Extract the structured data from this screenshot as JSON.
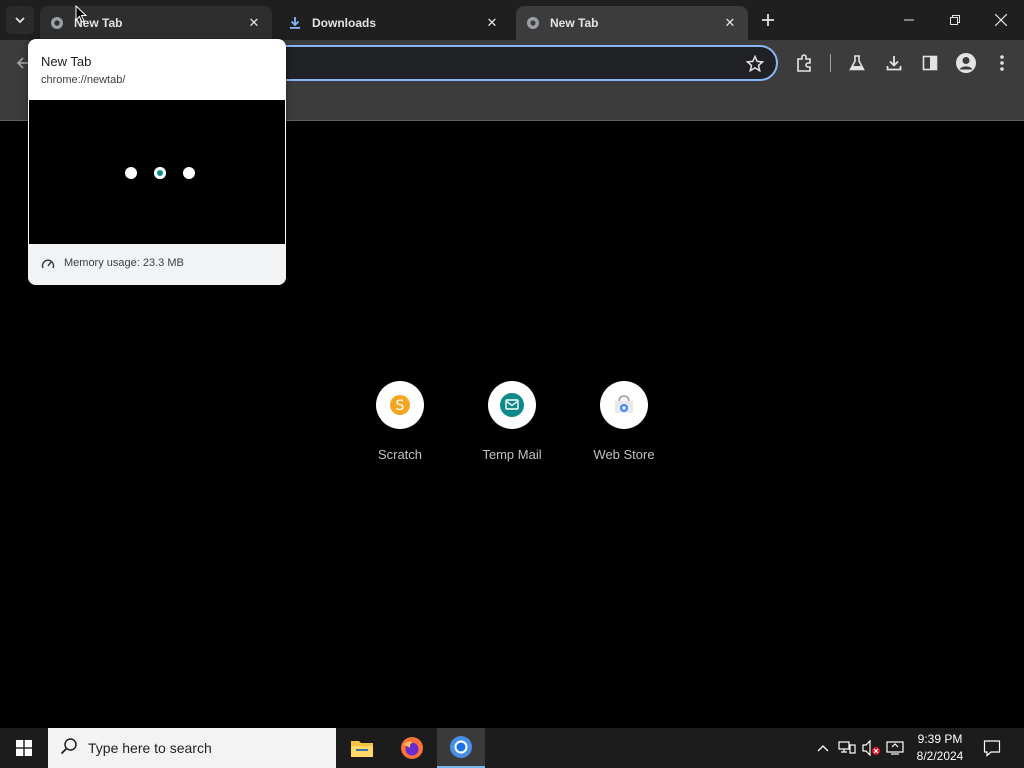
{
  "tabs": [
    {
      "title": "New Tab",
      "state": "hover",
      "icon": "globe-icon"
    },
    {
      "title": "Downloads",
      "state": "normal",
      "icon": "download-icon"
    },
    {
      "title": "New Tab",
      "state": "active",
      "icon": "globe-icon"
    }
  ],
  "hover_card": {
    "title": "New Tab",
    "url": "chrome://newtab/",
    "memory": "Memory usage: 23.3 MB"
  },
  "shortcuts": [
    {
      "label": "Scratch",
      "icon": "scratch-icon",
      "color": "#f6a623"
    },
    {
      "label": "Temp Mail",
      "icon": "temp-mail-icon",
      "color": "#0f8a8a"
    },
    {
      "label": "Web Store",
      "icon": "web-store-icon",
      "color": "#4285f4"
    }
  ],
  "taskbar": {
    "search_placeholder": "Type here to search",
    "time": "9:39 PM",
    "date": "8/2/2024"
  },
  "colors": {
    "omnibox_focus": "#8ab4f8",
    "toolbar": "#3c3c3c",
    "tabstrip": "#1f1f1f"
  }
}
